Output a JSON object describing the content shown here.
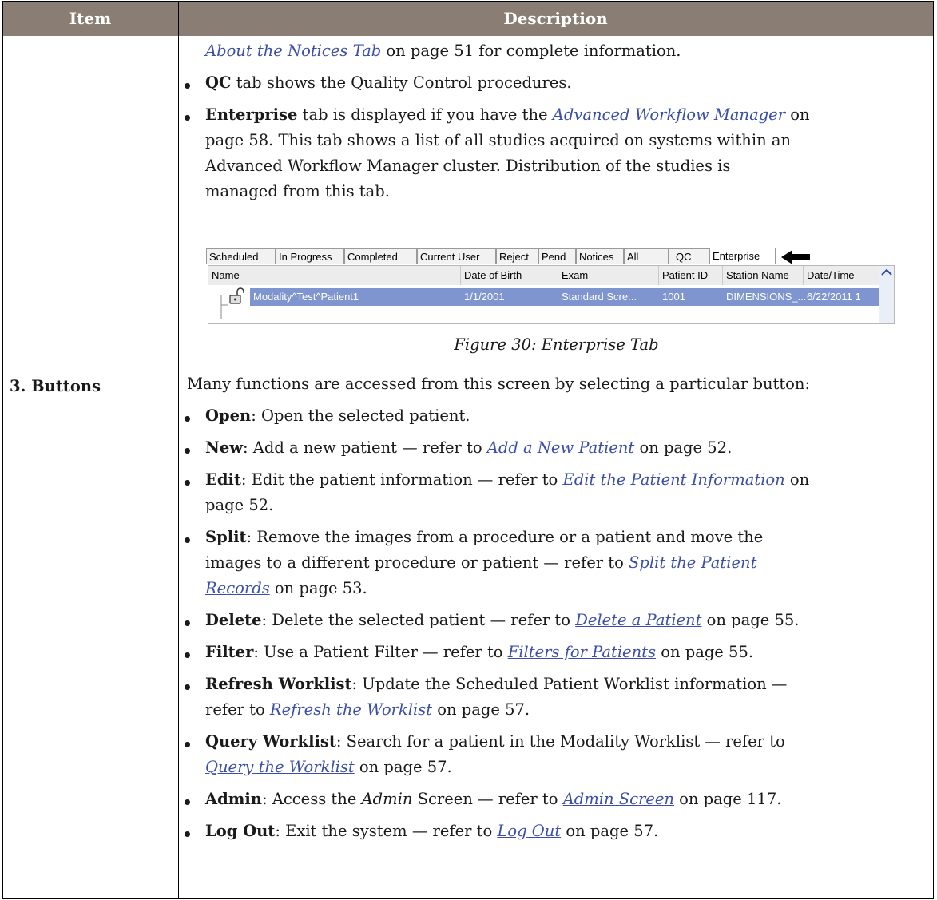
{
  "header": {
    "item": "Item",
    "description": "Description"
  },
  "row2": {
    "line0_link": "About the Notices Tab",
    "line0_rest": " on page 51 for complete information.",
    "qc_bold": "QC",
    "qc_rest": " tab shows the Quality Control procedures.",
    "ent_bold": "Enterprise",
    "ent_mid": " tab is displayed if you have the ",
    "ent_link": "Advanced Workflow Manager",
    "ent_on": " on",
    "ent_l2": "page 58. This tab shows a list of all studies acquired on systems within an",
    "ent_l3": "Advanced Workflow Manager cluster. Distribution of the studies is",
    "ent_l4": "managed from this tab."
  },
  "screenshot": {
    "tabs": [
      "Scheduled",
      "In Progress",
      "Completed",
      "Current User",
      "Reject",
      "Pend",
      "Notices",
      "All",
      "QC",
      "Enterprise"
    ],
    "active_tab": "Enterprise",
    "columns": [
      "Name",
      "Date of Birth",
      "Exam",
      "Patient ID",
      "Station Name",
      "Date/Time"
    ],
    "row": {
      "name": "Modality^Test^Patient1",
      "dob": "1/1/2001",
      "exam": "Standard Scre...",
      "patient_id": "1001",
      "station": "DIMENSIONS_...",
      "datetime": "6/22/2011 1"
    }
  },
  "caption": "Figure 30: Enterprise Tab",
  "row3": {
    "label": "3. Buttons",
    "intro": "Many functions are accessed from this screen by selecting a particular button:",
    "open_b": "Open",
    "open_t": ": Open the selected patient.",
    "new_b": "New",
    "new_t": ": Add a new patient — refer to ",
    "new_l": "Add a New Patient",
    "new_p": " on page 52.",
    "edit_b": "Edit",
    "edit_t": ": Edit the patient information — refer to ",
    "edit_l": "Edit the Patient Information",
    "edit_on": " on",
    "edit_p2": "page 52.",
    "split_b": "Split",
    "split_t": ": Remove the images from a procedure or a patient and move the",
    "split_l2": "images to a different procedure or patient — refer to ",
    "split_l": "Split the Patient",
    "split_l3": "Records",
    "split_p": " on page 53.",
    "delete_b": "Delete",
    "delete_t": ": Delete the selected patient — refer to ",
    "delete_l": "Delete a Patient",
    "delete_p": " on page 55.",
    "filter_b": "Filter",
    "filter_t": ": Use a Patient Filter — refer to ",
    "filter_l": "Filters for Patients",
    "filter_p": " on page 55.",
    "refresh_b": "Refresh Worklist",
    "refresh_t": ": Update the Scheduled Patient Worklist information —",
    "refresh_l2": "refer to ",
    "refresh_l": "Refresh the Worklist",
    "refresh_p": " on page 57.",
    "query_b": "Query Worklist",
    "query_t": ": Search for a patient in the Modality Worklist — refer to",
    "query_l": "Query the Worklist",
    "query_p": " on page 57.",
    "admin_b": "Admin",
    "admin_t1": ": Access the ",
    "admin_i": "Admin",
    "admin_t2": " Screen — refer to ",
    "admin_l": "Admin Screen",
    "admin_p": " on page 117.",
    "logout_b": "Log Out",
    "logout_t": ": Exit the system — refer to ",
    "logout_l": "Log Out",
    "logout_p": " on page 57."
  }
}
